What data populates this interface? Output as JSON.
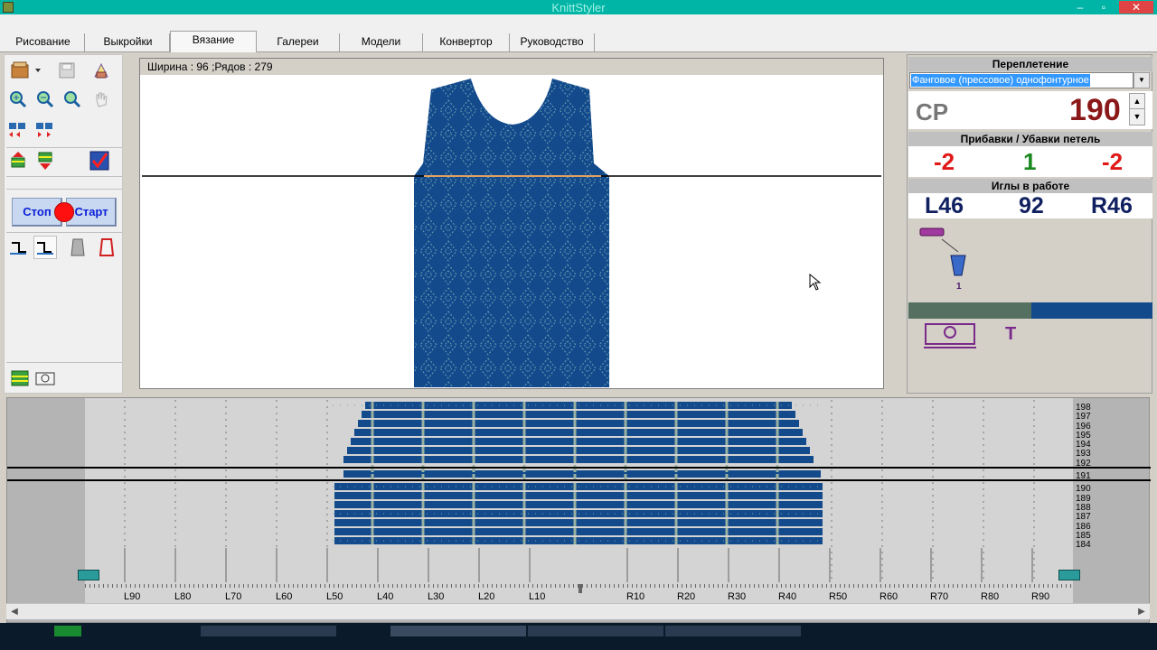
{
  "window": {
    "title": "KnittStyler",
    "min_glyph": "–",
    "max_glyph": "▫",
    "close_glyph": "✕"
  },
  "tabs": [
    {
      "label": "Рисование"
    },
    {
      "label": "Выкройки"
    },
    {
      "label": "Вязание",
      "active": true
    },
    {
      "label": "Галереи"
    },
    {
      "label": "Модели"
    },
    {
      "label": "Конвертор"
    },
    {
      "label": "Руководство"
    }
  ],
  "toolbar": {
    "stop_label": "Стоп",
    "start_label": "Старт"
  },
  "canvas": {
    "info": "Ширина : 96 ;Рядов : 279"
  },
  "right": {
    "stitch_header": "Переплетение",
    "stitch_selected": "Фанговое (прессовое) однофонтурное",
    "carriage_mode": "CP",
    "row_counter": "190",
    "inc_dec_header": "Прибавки / Убавки петель",
    "inc_left": "-2",
    "inc_mid": "1",
    "inc_right": "-2",
    "needles_header": "Иглы в работе",
    "needles_left": "L46",
    "needles_total": "92",
    "needles_right": "R46",
    "yarn_feeder": "1",
    "cam_label": "T"
  },
  "bed": {
    "row_labels": [
      "198",
      "197",
      "196",
      "195",
      "194",
      "193",
      "192",
      "191",
      "190",
      "189",
      "188",
      "187",
      "186",
      "185",
      "184"
    ],
    "needle_labels_left": [
      "L90",
      "L80",
      "L70",
      "L60",
      "L50",
      "L40",
      "L30",
      "L20",
      "L10"
    ],
    "needle_labels_right": [
      "R10",
      "R20",
      "R30",
      "R40",
      "R50",
      "R60",
      "R70",
      "R80",
      "R90"
    ]
  },
  "colors": {
    "knit_blue": "#124a8c",
    "knit_light": "#6f9fb0",
    "titlebar": "#00b5a5",
    "red": "#ff1010"
  }
}
